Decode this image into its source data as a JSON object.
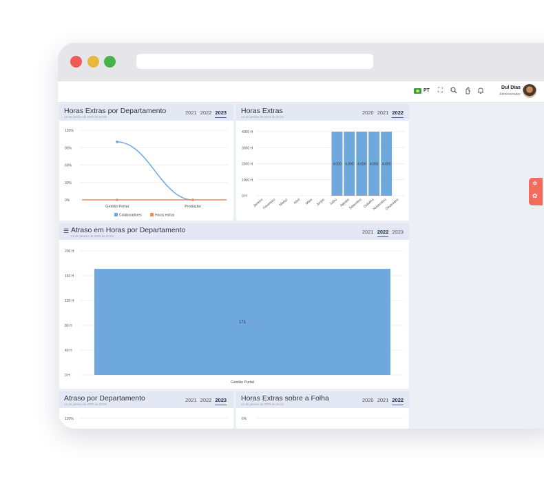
{
  "topbar": {
    "lang": "PT",
    "icons": [
      "expand-icon",
      "search-icon",
      "hand-icon",
      "bell-icon"
    ],
    "user_name": "Dul Dias",
    "user_role": "Administrador"
  },
  "cards": {
    "he_dept": {
      "title": "Horas Extras por Departamento",
      "subtitle": "12 de janeiro de 2023 às 20:06",
      "years": [
        "2021",
        "2022",
        "2023"
      ],
      "active_year": "2023"
    },
    "he": {
      "title": "Horas Extras",
      "subtitle": "12 de janeiro de 2023 às 20:21",
      "years": [
        "2020",
        "2021",
        "2022"
      ],
      "active_year": "2022"
    },
    "atraso_horas": {
      "title": "Atraso em Horas por Departamento",
      "subtitle": "12 de janeiro de 2023 às 20:04",
      "years": [
        "2021",
        "2022",
        "2023"
      ],
      "active_year": "2022"
    },
    "atraso_dept": {
      "title": "Atraso por Departamento",
      "subtitle": "12 de janeiro de 2023 às 20:06",
      "years": [
        "2021",
        "2022",
        "2023"
      ],
      "active_year": "2023"
    },
    "he_folha": {
      "title": "Horas Extras sobre a Folha",
      "subtitle": "12 de janeiro de 2023 às 20:21",
      "years": [
        "2020",
        "2021",
        "2022"
      ],
      "active_year": "2022"
    }
  },
  "chart_data": [
    {
      "type": "line",
      "categories": [
        "Gestão Portal",
        "Produção"
      ],
      "series": [
        {
          "name": "Colaboradores",
          "values": [
            100,
            0
          ],
          "color": "#6fa8dc"
        },
        {
          "name": "Horas extras",
          "values": [
            0,
            0
          ],
          "color": "#f08a5d"
        }
      ],
      "y_ticks": [
        "120%",
        "90%",
        "60%",
        "30%",
        "0%"
      ],
      "ylim": [
        0,
        120
      ],
      "legend": "bottom",
      "grid": true
    },
    {
      "type": "bar",
      "categories": [
        "Janeiro",
        "Fevereiro",
        "Março",
        "Abril",
        "Maio",
        "Junho",
        "Julho",
        "Agosto",
        "Setembro",
        "Outubro",
        "Novembro",
        "Dezembro"
      ],
      "values": [
        0,
        0,
        0,
        0,
        0,
        0,
        4000,
        4000,
        4000,
        4000,
        4000,
        0
      ],
      "labels": [
        "",
        "",
        "",
        "",
        "",
        "",
        "4.000",
        "4.000",
        "4.000",
        "4.000",
        "4.000",
        ""
      ],
      "y_ticks": [
        "4000 H",
        "3000 H",
        "2000 H",
        "1000 H",
        "0 H"
      ],
      "ylim": [
        0,
        4000
      ],
      "color": "#6fa8dc",
      "grid": true
    },
    {
      "type": "bar",
      "categories": [
        "Gestão Portal"
      ],
      "values": [
        171
      ],
      "labels": [
        "171"
      ],
      "y_ticks": [
        "200 H",
        "160 H",
        "120 H",
        "80 H",
        "40 H",
        "0 H"
      ],
      "ylim": [
        0,
        200
      ],
      "color": "#6fa8dc",
      "grid": true
    },
    {
      "type": "bar",
      "y_ticks": [
        "120%"
      ],
      "ylim": [
        0,
        120
      ],
      "grid": true
    },
    {
      "type": "bar",
      "y_ticks": [
        "6%"
      ],
      "ylim": [
        0,
        6
      ],
      "grid": true
    }
  ]
}
